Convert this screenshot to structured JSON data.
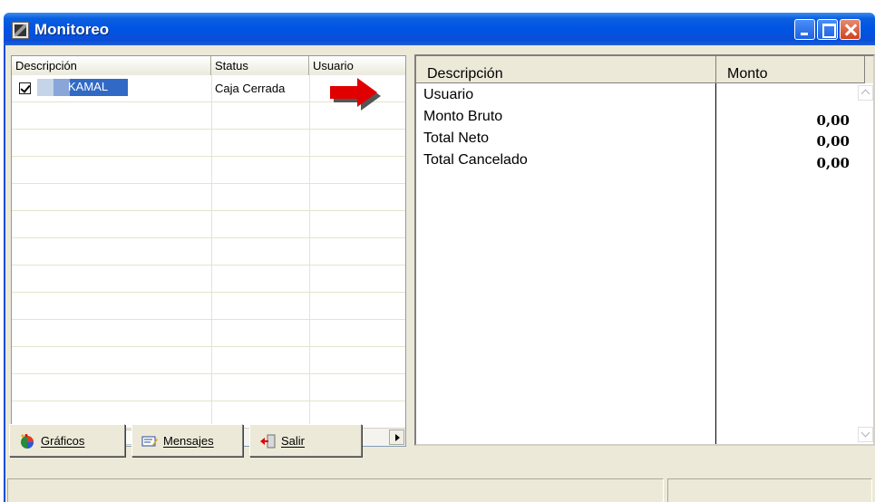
{
  "window": {
    "title": "Monitoreo"
  },
  "left_grid": {
    "columns": [
      "Descripción",
      "Status",
      "Usuario"
    ],
    "rows": [
      {
        "checked": true,
        "descripcion": "KAMAL",
        "status": "Caja Cerrada",
        "usuario": ""
      }
    ]
  },
  "right_grid": {
    "columns": [
      "Descripción",
      "Monto"
    ],
    "rows": [
      {
        "descripcion": "Usuario",
        "monto": ""
      },
      {
        "descripcion": "Monto Bruto",
        "monto": "0,00"
      },
      {
        "descripcion": "Total Neto",
        "monto": "0,00"
      },
      {
        "descripcion": "Total Cancelado",
        "monto": "0,00"
      }
    ]
  },
  "buttons": {
    "graficos": "Gráficos",
    "mensajes": "Mensajes",
    "salir": "Salir"
  },
  "icons": {
    "window": "app-icon",
    "graficos": "pie-chart-icon",
    "mensajes": "message-icon",
    "salir": "exit-door-icon",
    "pointer": "red-arrow-icon"
  },
  "colors": {
    "titlebar": "#0054e3",
    "selection": "#316ac5",
    "arrow": "#e00000",
    "window_bg": "#ece9d8"
  }
}
